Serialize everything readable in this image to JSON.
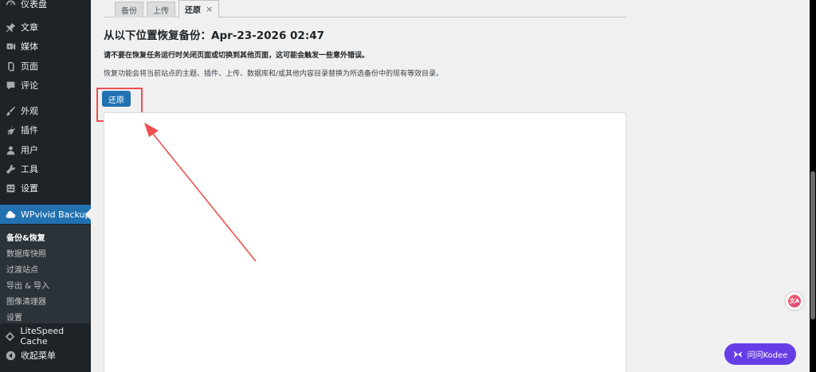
{
  "sidebar": {
    "top_partial_label": "仪表盘",
    "items": [
      {
        "label": "文章",
        "icon": "pin-icon"
      },
      {
        "label": "媒体",
        "icon": "media-icon"
      },
      {
        "label": "页面",
        "icon": "page-icon"
      },
      {
        "label": "评论",
        "icon": "comment-icon"
      },
      {
        "label": "外观",
        "icon": "brush-icon"
      },
      {
        "label": "插件",
        "icon": "plugin-icon"
      },
      {
        "label": "用户",
        "icon": "user-icon"
      },
      {
        "label": "工具",
        "icon": "wrench-icon"
      },
      {
        "label": "设置",
        "icon": "settings-icon"
      }
    ],
    "active_plugin": {
      "label": "WPvivid Backup",
      "icon": "cloud-icon"
    },
    "submenu": [
      "备份&恢复",
      "数据库快照",
      "过渡站点",
      "导出 & 导入",
      "图像清理器",
      "设置"
    ],
    "litespeed": {
      "label": "LiteSpeed Cache",
      "icon": "diamond-icon"
    },
    "collapse": {
      "label": "收起菜单",
      "icon": "collapse-icon"
    }
  },
  "tabs": [
    {
      "label": "备份"
    },
    {
      "label": "上传"
    },
    {
      "label": "还原",
      "close": "×"
    }
  ],
  "main": {
    "title": "从以下位置恢复备份：Apr-23-2026 02:47",
    "warning": "请不要在恢复任务运行时关闭页面或切换到其他页面，这可能会触发一些意外错误。",
    "description": "恢复功能会将当前站点的主题、插件、上传、数据库和/或其他内容目录替换为所选备份中的现有等效目录。",
    "restore_button": "还原"
  },
  "floating": {
    "translate_label": "文A",
    "kodee_label": "问问Kodee"
  },
  "colors": {
    "sidebar_bg": "#1d2327",
    "accent": "#2271b1",
    "highlight": "#ef4e4e",
    "kodee": "#673de6"
  }
}
